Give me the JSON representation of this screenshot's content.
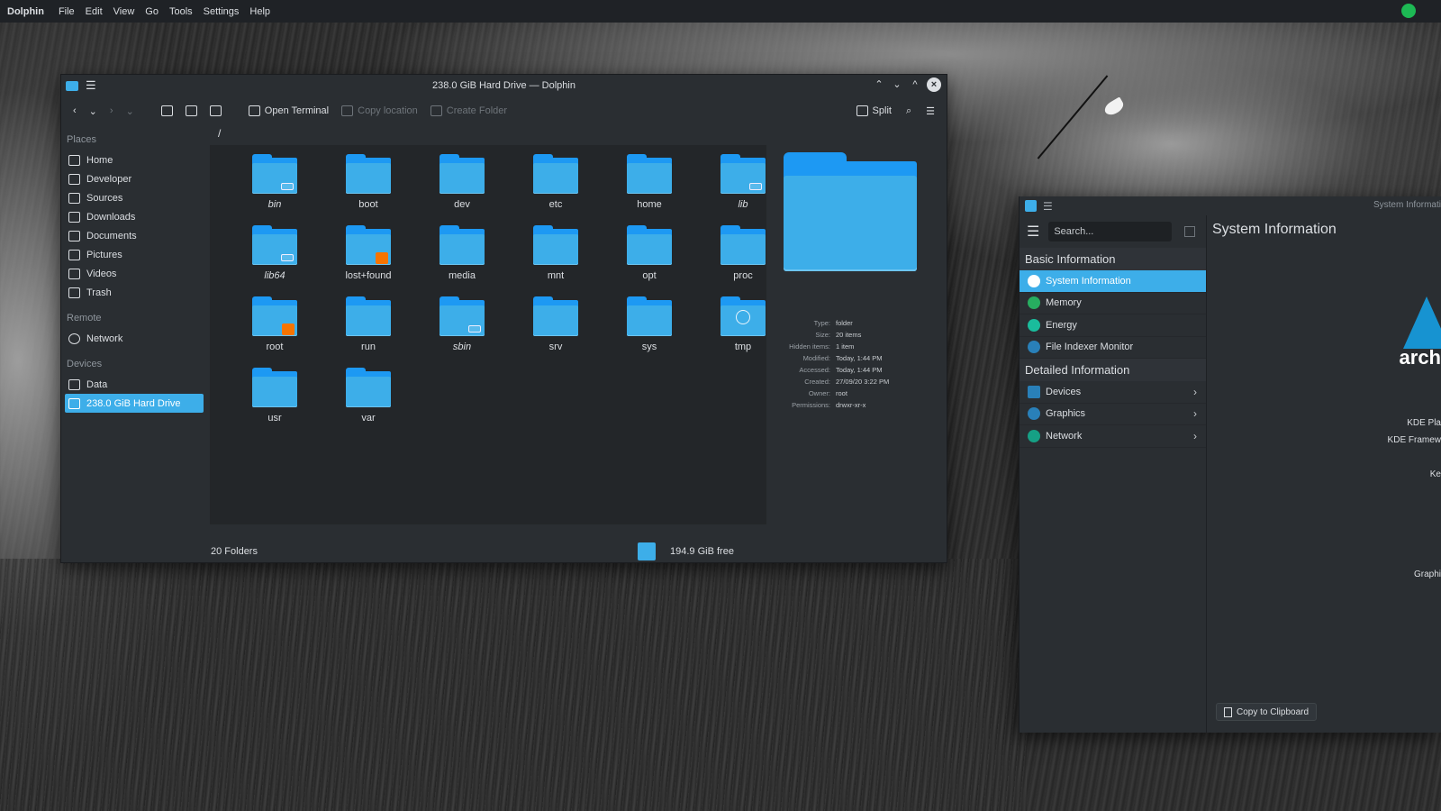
{
  "topbar": {
    "app_name": "Dolphin",
    "menu": [
      "File",
      "Edit",
      "View",
      "Go",
      "Tools",
      "Settings",
      "Help"
    ]
  },
  "dolphin": {
    "title": "238.0 GiB Hard Drive — Dolphin",
    "toolbar": {
      "open_terminal": "Open Terminal",
      "copy_location": "Copy location",
      "create_folder": "Create Folder",
      "split": "Split"
    },
    "places": {
      "section_places": "Places",
      "places_items": [
        "Home",
        "Developer",
        "Sources",
        "Downloads",
        "Documents",
        "Pictures",
        "Videos",
        "Trash"
      ],
      "section_remote": "Remote",
      "remote_items": [
        "Network"
      ],
      "section_devices": "Devices",
      "device_items": [
        "Data",
        "238.0 GiB Hard Drive"
      ],
      "selected": "238.0 GiB Hard Drive"
    },
    "path": "/",
    "files": [
      {
        "name": "bin",
        "italic": true,
        "badge": "link"
      },
      {
        "name": "boot",
        "italic": false,
        "badge": ""
      },
      {
        "name": "dev",
        "italic": false,
        "badge": ""
      },
      {
        "name": "etc",
        "italic": false,
        "badge": ""
      },
      {
        "name": "home",
        "italic": false,
        "badge": ""
      },
      {
        "name": "lib",
        "italic": true,
        "badge": "link"
      },
      {
        "name": "lib64",
        "italic": true,
        "badge": "link"
      },
      {
        "name": "lost+found",
        "italic": false,
        "badge": "lock"
      },
      {
        "name": "media",
        "italic": false,
        "badge": ""
      },
      {
        "name": "mnt",
        "italic": false,
        "badge": ""
      },
      {
        "name": "opt",
        "italic": false,
        "badge": ""
      },
      {
        "name": "proc",
        "italic": false,
        "badge": ""
      },
      {
        "name": "root",
        "italic": false,
        "badge": "lock"
      },
      {
        "name": "run",
        "italic": false,
        "badge": ""
      },
      {
        "name": "sbin",
        "italic": true,
        "badge": "link"
      },
      {
        "name": "srv",
        "italic": false,
        "badge": ""
      },
      {
        "name": "sys",
        "italic": false,
        "badge": ""
      },
      {
        "name": "tmp",
        "italic": false,
        "badge": "clock"
      },
      {
        "name": "usr",
        "italic": false,
        "badge": ""
      },
      {
        "name": "var",
        "italic": false,
        "badge": ""
      }
    ],
    "info": {
      "type_label": "Type:",
      "type": "folder",
      "size_label": "Size:",
      "size": "20 items",
      "hidden_label": "Hidden items:",
      "hidden": "1 item",
      "modified_label": "Modified:",
      "modified": "Today, 1:44 PM",
      "accessed_label": "Accessed:",
      "accessed": "Today, 1:44 PM",
      "created_label": "Created:",
      "created": "27/09/20 3:22 PM",
      "owner_label": "Owner:",
      "owner": "root",
      "permissions_label": "Permissions:",
      "permissions": "drwxr-xr-x"
    },
    "status": {
      "count": "20 Folders",
      "free": "194.9 GiB free"
    }
  },
  "info_center": {
    "title": "System Informati",
    "search_placeholder": "Search...",
    "basic_heading": "Basic Information",
    "basic_items": [
      "System Information",
      "Memory",
      "Energy",
      "File Indexer Monitor"
    ],
    "detailed_heading": "Detailed Information",
    "detailed_items": [
      "Devices",
      "Graphics",
      "Network"
    ],
    "page_title": "System Information",
    "logo_text": "arch",
    "labels": [
      "KDE Pla",
      "KDE Framew",
      "Ke",
      "Graphi"
    ],
    "copy_button": "Copy to Clipboard"
  },
  "colors": {
    "accent": "#3daee9",
    "folder_dark": "#1d99f3",
    "window_bg": "#2a2e32",
    "view_bg": "#232629",
    "lock_badge": "#f67400",
    "arch_blue": "#1793d1"
  }
}
